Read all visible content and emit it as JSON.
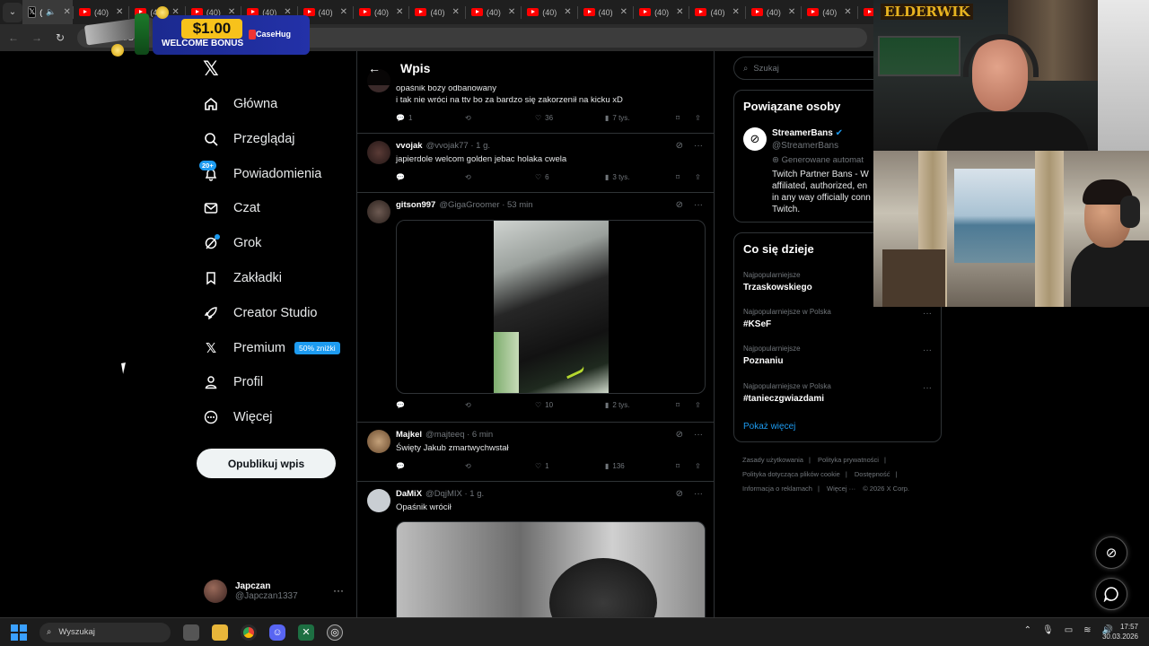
{
  "browser": {
    "active_tab_label": "(",
    "inactive_tab_label": "(40)",
    "tab_count_inactive": 15,
    "address": "x.com/S"
  },
  "promo": {
    "amount": "$1.00",
    "bonus": "WELCOME BONUS",
    "brand": "CaseHug"
  },
  "sidebar": {
    "items": [
      {
        "label": "Główna",
        "icon": "home-icon"
      },
      {
        "label": "Przeglądaj",
        "icon": "search-icon"
      },
      {
        "label": "Powiadomienia",
        "icon": "bell-icon",
        "badge": "20+"
      },
      {
        "label": "Czat",
        "icon": "mail-icon"
      },
      {
        "label": "Grok",
        "icon": "grok-icon"
      },
      {
        "label": "Zakładki",
        "icon": "bookmark-icon"
      },
      {
        "label": "Creator Studio",
        "icon": "rocket-icon"
      },
      {
        "label": "Premium",
        "icon": "x-icon",
        "badge": "50% zniżki"
      },
      {
        "label": "Profil",
        "icon": "person-icon"
      },
      {
        "label": "Więcej",
        "icon": "more-circle-icon"
      }
    ],
    "post_button": "Opublikuj wpis",
    "account": {
      "name": "Japczan",
      "handle": "@Japczan1337"
    }
  },
  "main": {
    "header": "Wpis",
    "tweets": [
      {
        "name": "",
        "handle": "",
        "time": "",
        "text": "opaśnik boży odbanowany\ni tak nie wróci na ttv bo za bardzo się zakorzenił na kicku xD",
        "replies": "1",
        "retweets": "",
        "likes": "36",
        "views": "7 tys."
      },
      {
        "name": "vvojak",
        "handle": "@vvojak77 · 1 g.",
        "time": "",
        "text": "japierdole welcom golden jebac holaka cwela",
        "replies": "",
        "retweets": "",
        "likes": "6",
        "views": "3 tys."
      },
      {
        "name": "gitson997",
        "handle": "@GigaGroomer · 53 min",
        "time": "",
        "text": "",
        "replies": "",
        "retweets": "",
        "likes": "10",
        "views": "2 tys."
      },
      {
        "name": "Majkel",
        "handle": "@majteeq · 6 min",
        "time": "",
        "text": "Święty Jakub zmartwychwstał",
        "replies": "",
        "retweets": "",
        "likes": "1",
        "views": "136"
      },
      {
        "name": "DaMiX",
        "handle": "@DqjMIX · 1 g.",
        "time": "",
        "text": "Opaśnik wrócił",
        "replies": "",
        "retweets": "",
        "likes": "",
        "views": ""
      }
    ]
  },
  "right": {
    "search_placeholder": "Szukaj",
    "related_title": "Powiązane osoby",
    "related_person": {
      "name": "StreamerBans",
      "handle": "@StreamerBans",
      "generated": "Generowane automat",
      "bio": "Twitch Partner Bans - W\naffiliated, authorized, en\nin any way officially conn\nTwitch."
    },
    "trends_title": "Co się dzieje",
    "trends": [
      {
        "category": "Najpopularniejsze",
        "name": "Trzaskowskiego"
      },
      {
        "category": "Najpopularniejsze w Polska",
        "name": "#KSeF"
      },
      {
        "category": "Najpopularniejsze",
        "name": "Poznaniu"
      },
      {
        "category": "Najpopularniejsze w Polska",
        "name": "#tanieczgwiazdami"
      }
    ],
    "show_more": "Pokaż więcej",
    "footer": [
      "Zasady użytkowania",
      "Polityka prywatności",
      "Polityka dotycząca plików cookie",
      "Dostępność",
      "Informacja o reklamach",
      "Więcej ···",
      "© 2026 X Corp."
    ]
  },
  "overlay": {
    "logo_text": "ELDERWIK"
  },
  "taskbar": {
    "search": "Wyszukaj",
    "time": "17:57",
    "date": "30.03.2026"
  },
  "colors": {
    "accent": "#1d9bf0",
    "border": "#2f3336",
    "muted": "#71767b"
  }
}
